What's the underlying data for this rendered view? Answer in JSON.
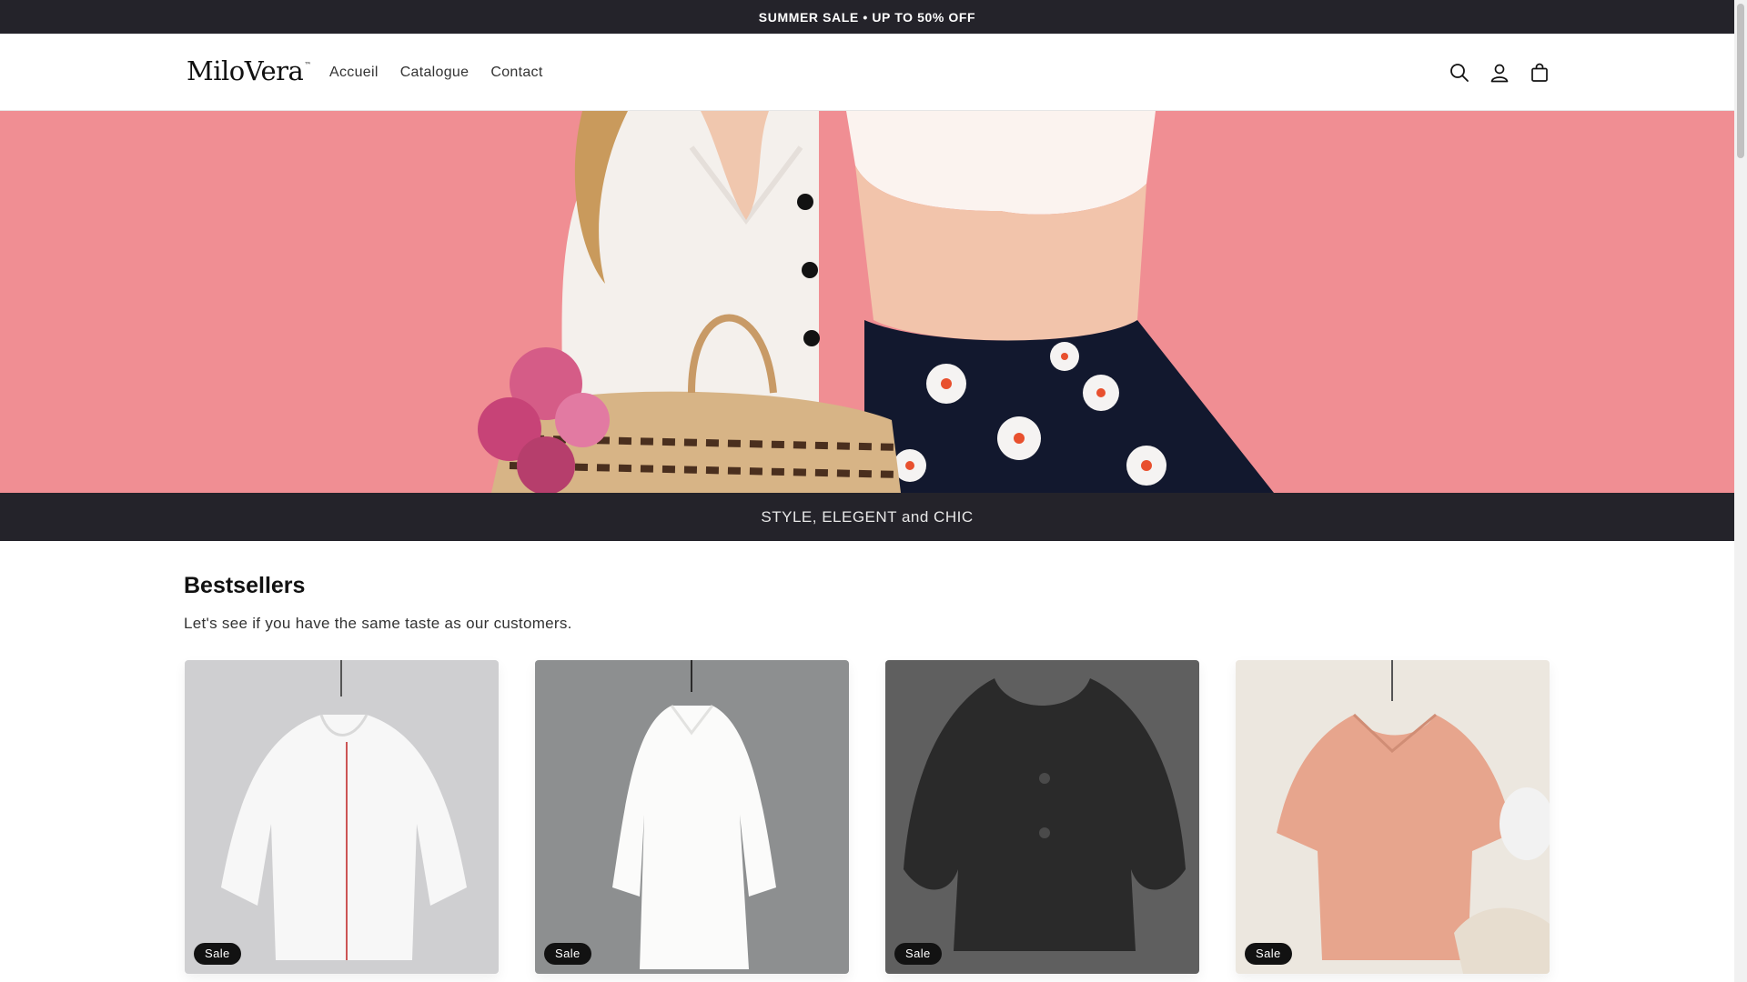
{
  "announcement": {
    "text": "SUMMER SALE • UP TO 50% OFF"
  },
  "header": {
    "logo": "MiloVera",
    "logo_mark": "™",
    "nav": [
      {
        "label": "Accueil"
      },
      {
        "label": "Catalogue"
      },
      {
        "label": "Contact"
      }
    ],
    "icons": [
      "search-icon",
      "account-icon",
      "cart-icon"
    ]
  },
  "hero": {
    "alt_colors": {
      "background": "#f08e93"
    }
  },
  "tagline": {
    "text": "STYLE, ELEGENT and CHIC"
  },
  "bestsellers": {
    "title": "Bestsellers",
    "subtitle": "Let's see if you have the same taste as our customers.",
    "products": [
      {
        "badge": "Sale",
        "color": "#ffffff"
      },
      {
        "badge": "Sale",
        "color": "#fafafa"
      },
      {
        "badge": "Sale",
        "color": "#2e2e2e"
      },
      {
        "badge": "Sale",
        "color": "#e7a58d"
      }
    ]
  },
  "colors": {
    "dark_bar": "#24232a",
    "badge": "#121212"
  }
}
